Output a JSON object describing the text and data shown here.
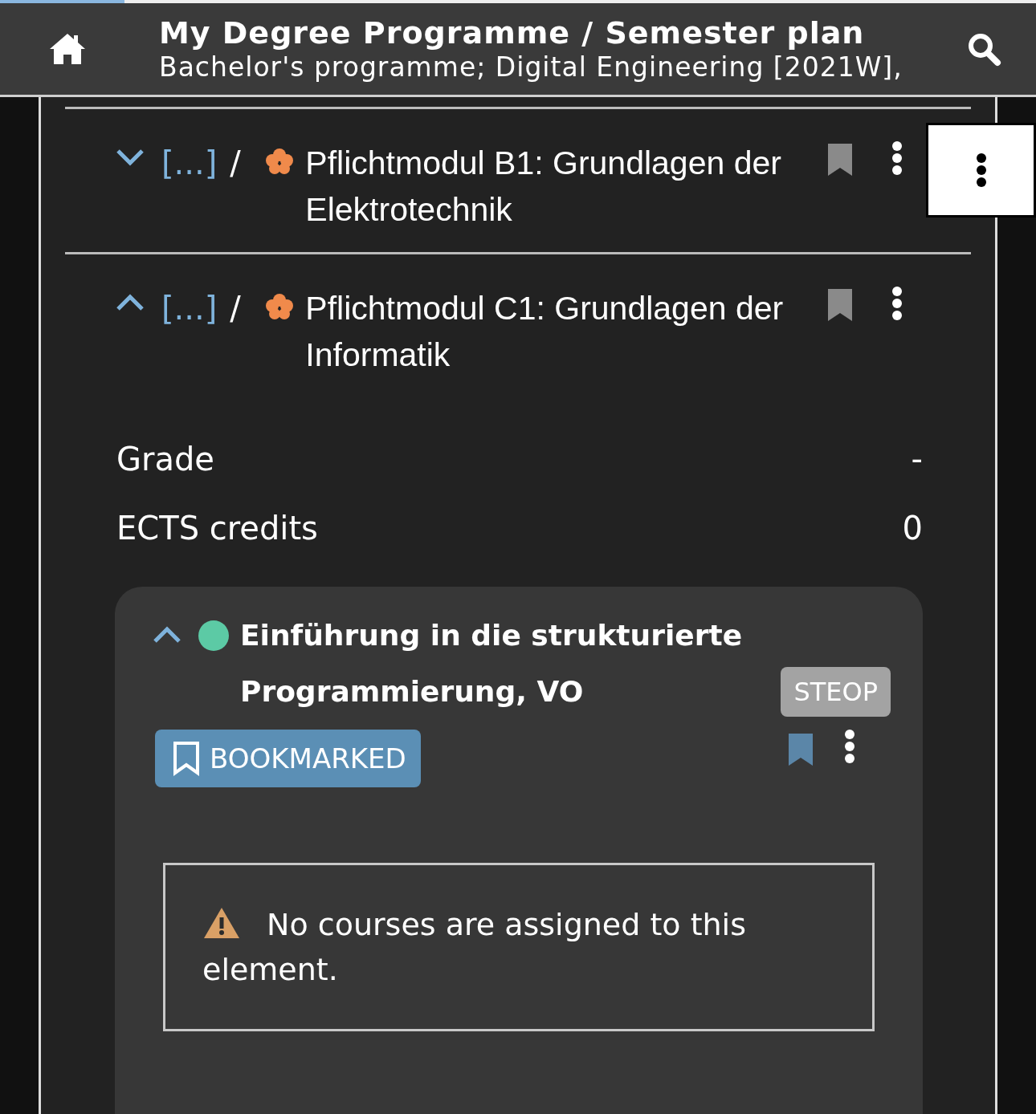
{
  "header": {
    "title": "My Degree Programme / Semester plan",
    "subtitle": "Bachelor's programme; Digital Engineering [2021W],",
    "progress": {
      "level": 0.12
    }
  },
  "modules": [
    {
      "breadcrumb": "[...]",
      "separator": "/",
      "title": "Pflichtmodul B1: Grundlagen der Elektrotechnik",
      "expanded": false,
      "bookmarked": false
    },
    {
      "breadcrumb": "[...]",
      "separator": "/",
      "title": "Pflichtmodul C1: Grundlagen der Informatik",
      "expanded": true,
      "bookmarked": false
    }
  ],
  "details": [
    {
      "label": "Grade",
      "value": "-"
    },
    {
      "label": "ECTS credits",
      "value": "0"
    }
  ],
  "course": {
    "expanded": true,
    "color": "#5ccaa5",
    "title": "Einführung in die strukturierte Programmierung, VO",
    "tag": "STEOP",
    "bookmark_button": "BOOKMARKED",
    "bookmarked": true,
    "notice": "No courses are assigned to this element."
  }
}
